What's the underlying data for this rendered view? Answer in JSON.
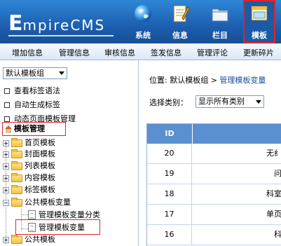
{
  "header": {
    "logo_letter": "E",
    "logo_rest": "mpireCMS",
    "nav": [
      {
        "label": "系统",
        "icon": "globe-icon"
      },
      {
        "label": "信息",
        "icon": "notepad-icon"
      },
      {
        "label": "栏目",
        "icon": "folder-icon"
      },
      {
        "label": "模板",
        "icon": "window-icon"
      }
    ],
    "active_index": 3
  },
  "subbar": {
    "items": [
      "增加信息",
      "管理信息",
      "审核信息",
      "签发信息",
      "管理评论",
      "更新碎片"
    ]
  },
  "left": {
    "group_select": "默认模板组",
    "links": [
      "查看标签语法",
      "自动生成标签",
      "动态页面模板管理"
    ],
    "root": "模板管理",
    "nodes": [
      "首页模板",
      "封面模板",
      "列表模板",
      "内容模板",
      "标签模板",
      "公共模板变量",
      "公共模板"
    ],
    "children": [
      "管理模板变量分类",
      "管理模板变量"
    ]
  },
  "main": {
    "crumb_prefix": "位置: 默认模板组 > ",
    "crumb_link": "管理模板变量",
    "filter_label": "选择类别：",
    "filter_value": "显示所有类别",
    "table": {
      "col_id": "ID",
      "rows": [
        {
          "id": "20",
          "name": "无纟"
        },
        {
          "id": "19",
          "name": "问"
        },
        {
          "id": "18",
          "name": "科室"
        },
        {
          "id": "17",
          "name": "单页"
        },
        {
          "id": "16",
          "name": "科"
        }
      ]
    }
  },
  "colors": {
    "header_blue": "#1c5fb0",
    "highlight_red": "#e0242a",
    "table_header": "#5a8fd0"
  }
}
